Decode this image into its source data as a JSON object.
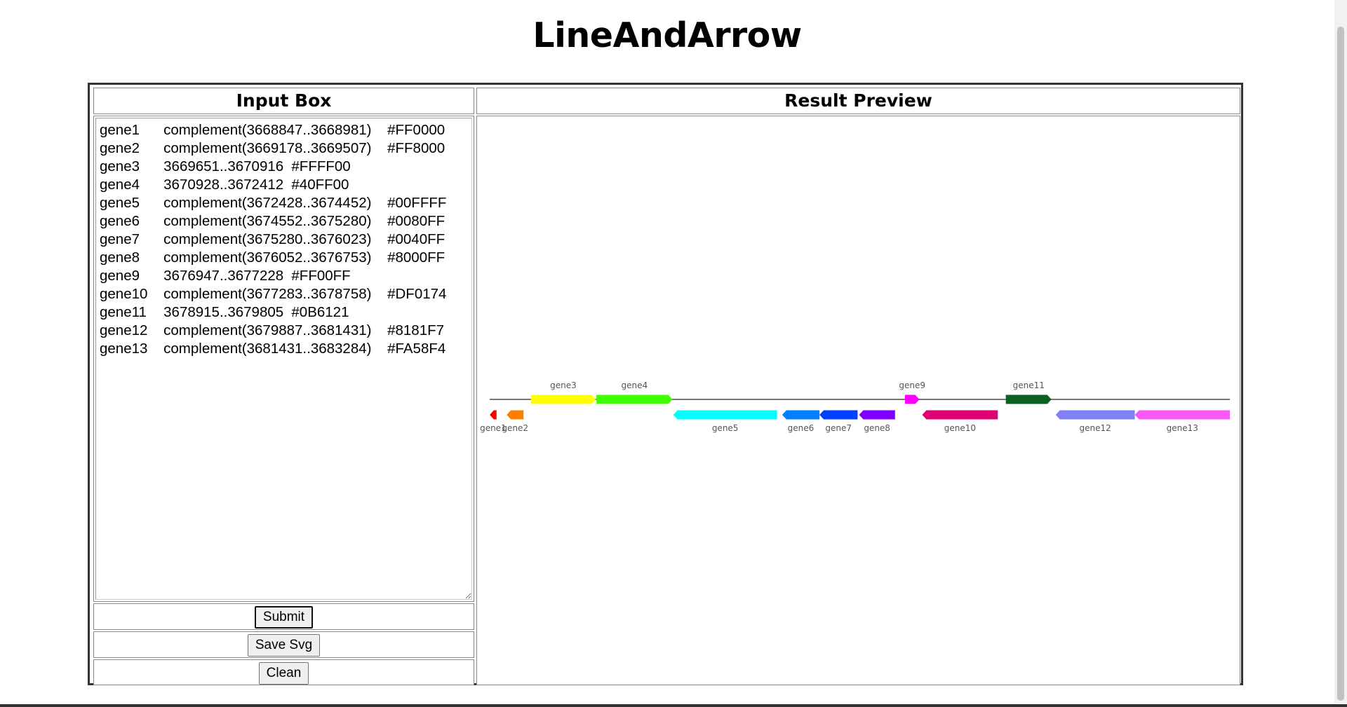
{
  "page": {
    "title": "LineAndArrow"
  },
  "input_box": {
    "header": "Input Box",
    "text": "gene1\tcomplement(3668847..3668981)\t#FF0000\ngene2\tcomplement(3669178..3669507)\t#FF8000\ngene3\t3669651..3670916\t#FFFF00\ngene4\t3670928..3672412\t#40FF00\ngene5\tcomplement(3672428..3674452)\t#00FFFF\ngene6\tcomplement(3674552..3675280)\t#0080FF\ngene7\tcomplement(3675280..3676023)\t#0040FF\ngene8\tcomplement(3676052..3676753)\t#8000FF\ngene9\t3676947..3677228\t#FF00FF\ngene10\tcomplement(3677283..3678758)\t#DF0174\ngene11\t3678915..3679805\t#0B6121\ngene12\tcomplement(3679887..3681431)\t#8181F7\ngene13\tcomplement(3681431..3683284)\t#FA58F4"
  },
  "buttons": {
    "submit": "Submit",
    "save_svg": "Save Svg",
    "clean": "Clean"
  },
  "preview": {
    "header": "Result Preview",
    "range": [
      3668847,
      3683284
    ],
    "genes": [
      {
        "name": "gene1",
        "start": 3668847,
        "end": 3668981,
        "strand": "-",
        "color": "#FF0000"
      },
      {
        "name": "gene2",
        "start": 3669178,
        "end": 3669507,
        "strand": "-",
        "color": "#FF8000"
      },
      {
        "name": "gene3",
        "start": 3669651,
        "end": 3670916,
        "strand": "+",
        "color": "#FFFF00"
      },
      {
        "name": "gene4",
        "start": 3670928,
        "end": 3672412,
        "strand": "+",
        "color": "#40FF00"
      },
      {
        "name": "gene5",
        "start": 3672428,
        "end": 3674452,
        "strand": "-",
        "color": "#00FFFF"
      },
      {
        "name": "gene6",
        "start": 3674552,
        "end": 3675280,
        "strand": "-",
        "color": "#0080FF"
      },
      {
        "name": "gene7",
        "start": 3675280,
        "end": 3676023,
        "strand": "-",
        "color": "#0040FF"
      },
      {
        "name": "gene8",
        "start": 3676052,
        "end": 3676753,
        "strand": "-",
        "color": "#8000FF"
      },
      {
        "name": "gene9",
        "start": 3676947,
        "end": 3677228,
        "strand": "+",
        "color": "#FF00FF"
      },
      {
        "name": "gene10",
        "start": 3677283,
        "end": 3678758,
        "strand": "-",
        "color": "#DF0174"
      },
      {
        "name": "gene11",
        "start": 3678915,
        "end": 3679805,
        "strand": "+",
        "color": "#0B6121"
      },
      {
        "name": "gene12",
        "start": 3679887,
        "end": 3681431,
        "strand": "-",
        "color": "#8181F7"
      },
      {
        "name": "gene13",
        "start": 3681431,
        "end": 3683284,
        "strand": "-",
        "color": "#FA58F4"
      }
    ]
  }
}
